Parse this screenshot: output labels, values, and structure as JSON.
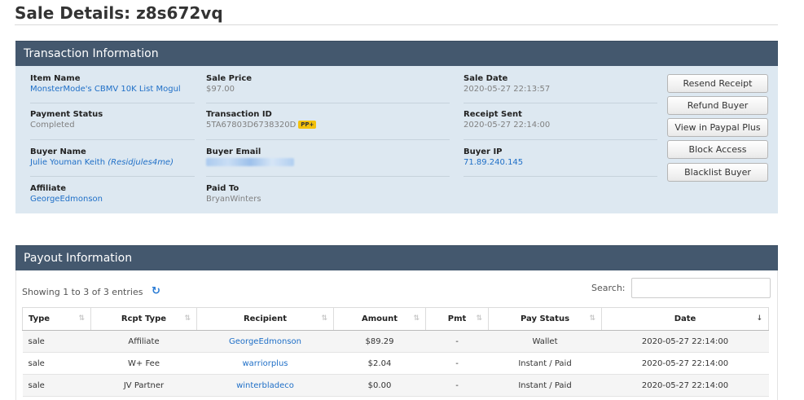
{
  "page": {
    "title": "Sale Details: z8s672vq"
  },
  "transaction": {
    "header": "Transaction Information",
    "item_name": {
      "label": "Item Name",
      "value": "MonsterMode's CBMV 10K List Mogul"
    },
    "sale_price": {
      "label": "Sale Price",
      "value": "$97.00"
    },
    "sale_date": {
      "label": "Sale Date",
      "value": "2020-05-27 22:13:57"
    },
    "payment_status": {
      "label": "Payment Status",
      "value": "Completed"
    },
    "transaction_id": {
      "label": "Transaction ID",
      "value": "5TA67803D6738320D",
      "badge": "PP+"
    },
    "receipt_sent": {
      "label": "Receipt Sent",
      "value": "2020-05-27 22:14:00"
    },
    "buyer_name": {
      "label": "Buyer Name",
      "value": "Julie Youman Keith",
      "handle": "(Residjules4me)"
    },
    "buyer_email": {
      "label": "Buyer Email"
    },
    "buyer_ip": {
      "label": "Buyer IP",
      "value": "71.89.240.145"
    },
    "affiliate": {
      "label": "Affiliate",
      "value": "GeorgeEdmonson"
    },
    "paid_to": {
      "label": "Paid To",
      "value": "BryanWinters"
    },
    "actions": {
      "resend_receipt": "Resend Receipt",
      "refund_buyer": "Refund Buyer",
      "view_paypal_plus": "View in Paypal Plus",
      "block_access": "Block Access",
      "blacklist_buyer": "Blacklist Buyer"
    }
  },
  "payout": {
    "header": "Payout Information",
    "showing": "Showing 1 to 3 of 3 entries",
    "search_label": "Search:",
    "columns": [
      "Type",
      "Rcpt Type",
      "Recipient",
      "Amount",
      "Pmt",
      "Pay Status",
      "Date"
    ],
    "rows": [
      [
        "sale",
        "Affiliate",
        "GeorgeEdmonson",
        "$89.29",
        "-",
        "Wallet",
        "2020-05-27 22:14:00"
      ],
      [
        "sale",
        "W+ Fee",
        "warriorplus",
        "$2.04",
        "-",
        "Instant / Paid",
        "2020-05-27 22:14:00"
      ],
      [
        "sale",
        "JV Partner",
        "winterbladeco",
        "$0.00",
        "-",
        "Instant / Paid",
        "2020-05-27 22:14:00"
      ]
    ]
  },
  "icons": {
    "refresh": "refresh-icon",
    "sort": "sort-icon"
  },
  "colors": {
    "panel_header": "#44586e",
    "panel_body": "#dde8f1",
    "link": "#1f6fc7",
    "badge": "#f3c10d"
  }
}
